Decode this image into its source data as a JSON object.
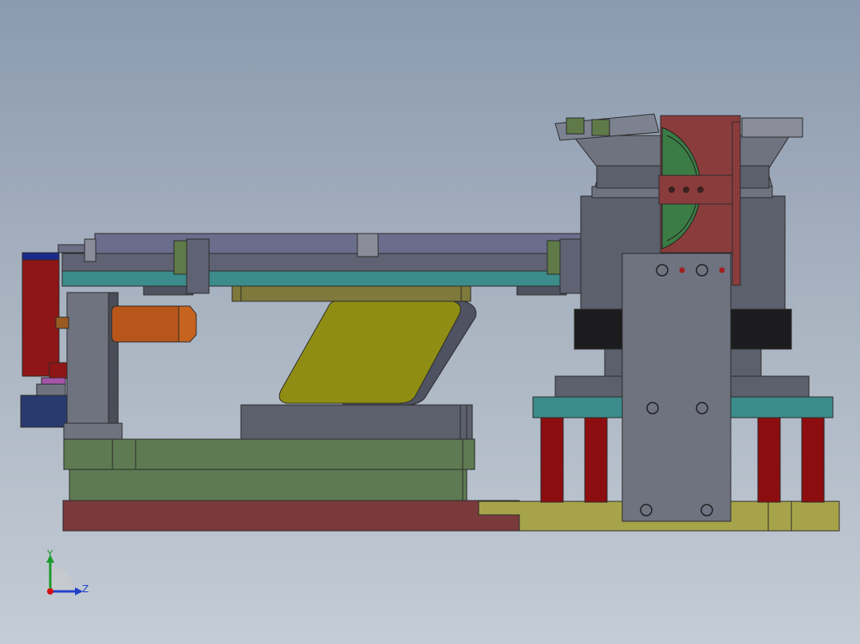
{
  "viewport": {
    "background_top": "#8b9ab0",
    "background_bottom": "#c4ccd5"
  },
  "model": {
    "palette": {
      "base_plate": "#7a3a3c",
      "olive_plate": "#a7a34a",
      "green_block": "#5e7a52",
      "yellow_slider": "#8f8d14",
      "steel_gray": "#6f7380",
      "dark_gray": "#4a4d57",
      "teal_rail": "#3b8c8a",
      "red_post": "#8c0d10",
      "red_block": "#8f1616",
      "orange_cylinder": "#b8551a",
      "maroon_cap": "#8a3c3c",
      "green_wheel": "#3b7c45",
      "navy": "#283a6e",
      "magenta": "#a455a8",
      "black_band": "#1c1c1e"
    }
  },
  "triad": {
    "y_label": "Y",
    "z_label": "Z",
    "y_color": "#1a9a2a",
    "z_color": "#1f3fc9",
    "x_color": "#d01010"
  }
}
